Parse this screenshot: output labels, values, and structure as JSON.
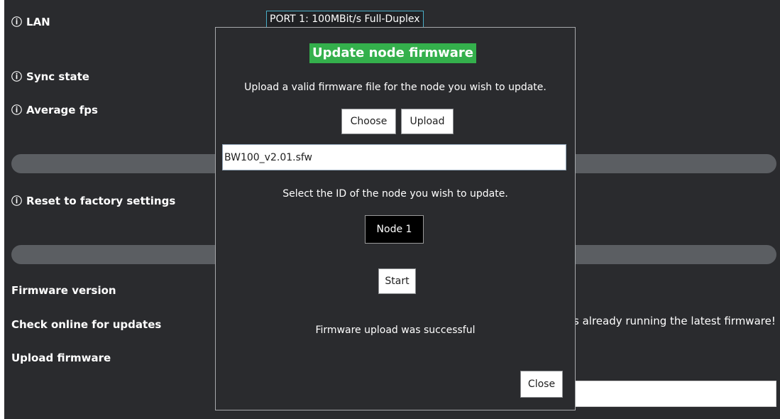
{
  "info_icon": "ⓘ",
  "settings": {
    "lan_label": "LAN",
    "lan_value": "PORT 1: 100MBit/s Full-Duplex",
    "sync_state_label": "Sync state",
    "average_fps_label": "Average fps",
    "reset_label": "Reset to factory settings",
    "firmware_version_label": "Firmware version",
    "check_updates_label": "Check online for updates",
    "upload_firmware_label": "Upload firmware",
    "update_message_partial": "s already running the latest firmware!"
  },
  "modal": {
    "title": "Update node firmware",
    "instructions": "Upload a valid firmware file for the node you wish to update.",
    "choose_button": "Choose",
    "upload_button": "Upload",
    "file_name": "BW100_v2.01.sfw",
    "select_instructions": "Select the ID of the node you wish to update.",
    "node_selected": "Node 1",
    "start_button": "Start",
    "status_message": "Firmware upload was successful",
    "close_button": "Close"
  },
  "colors": {
    "background": "#2a2b2e",
    "title_accent": "#34b04c",
    "separator": "#5b5e62",
    "port_border": "#49aec7"
  }
}
